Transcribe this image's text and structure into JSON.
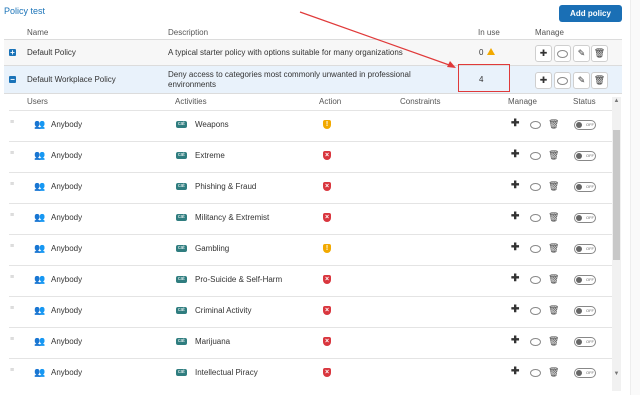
{
  "breadcrumb": "Policy test",
  "add_policy": "Add policy",
  "headers": {
    "name": "Name",
    "description": "Description",
    "in_use": "In use",
    "manage": "Manage"
  },
  "policies": [
    {
      "name": "Default Policy",
      "description": "A typical starter policy with options suitable for many organizations",
      "in_use": "0",
      "expand": "+"
    },
    {
      "name": "Default Workplace Policy",
      "description_line1": "Deny access to categories most commonly unwanted in professional",
      "description_line2": "environments",
      "in_use": "4",
      "expand": "−"
    }
  ],
  "sub_headers": {
    "users": "Users",
    "activities": "Activities",
    "action": "Action",
    "constraints": "Constraints",
    "manage": "Manage",
    "status": "Status"
  },
  "rules": [
    {
      "user": "Anybody",
      "cat": "cat",
      "activity": "Weapons",
      "action": "warn"
    },
    {
      "user": "Anybody",
      "cat": "cat",
      "activity": "Extreme",
      "action": "block"
    },
    {
      "user": "Anybody",
      "cat": "cat",
      "activity": "Phishing & Fraud",
      "action": "block"
    },
    {
      "user": "Anybody",
      "cat": "cat",
      "activity": "Militancy & Extremist",
      "action": "block"
    },
    {
      "user": "Anybody",
      "cat": "cat",
      "activity": "Gambling",
      "action": "warn"
    },
    {
      "user": "Anybody",
      "cat": "cat",
      "activity": "Pro-Suicide & Self-Harm",
      "action": "block"
    },
    {
      "user": "Anybody",
      "cat": "cat",
      "activity": "Criminal Activity",
      "action": "block"
    },
    {
      "user": "Anybody",
      "cat": "cat",
      "activity": "Marijuana",
      "action": "block"
    },
    {
      "user": "Anybody",
      "cat": "cat",
      "activity": "Intellectual Piracy",
      "action": "block"
    }
  ],
  "toggle_label": "OFF",
  "colors": {
    "accent": "#1a6fb5",
    "block": "#d9363e",
    "warn": "#f2a900",
    "annotation": "#e03a3a"
  }
}
